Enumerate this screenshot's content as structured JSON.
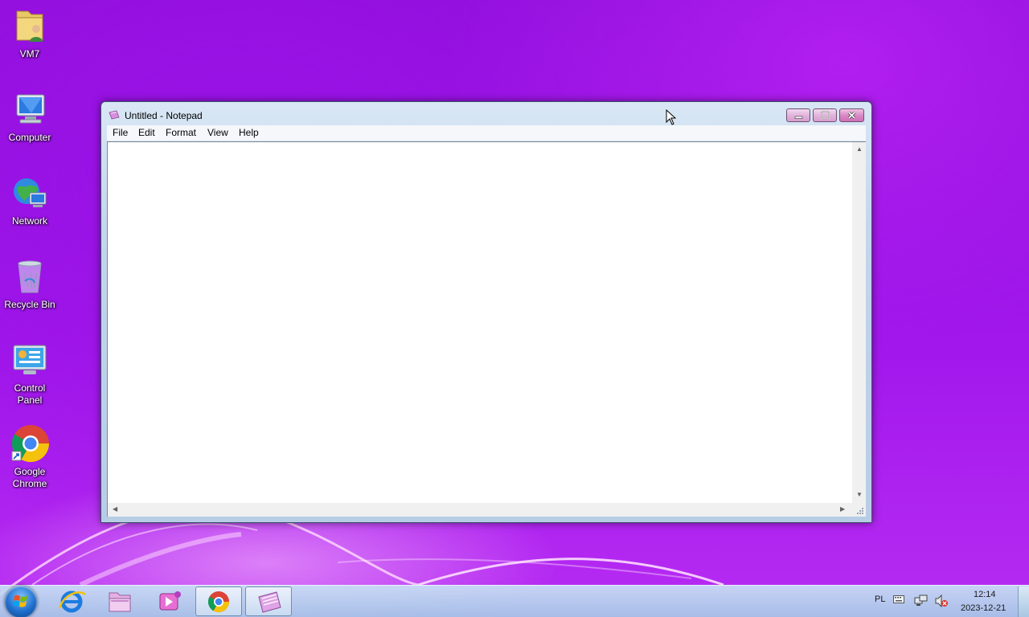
{
  "desktop": {
    "icons": [
      {
        "label": "VM7",
        "icon": "user-folder-icon"
      },
      {
        "label": "Computer",
        "icon": "computer-icon"
      },
      {
        "label": "Network",
        "icon": "network-icon"
      },
      {
        "label": "Recycle Bin",
        "icon": "recycle-bin-icon"
      },
      {
        "label_line1": "Control",
        "label_line2": "Panel",
        "icon": "control-panel-icon"
      },
      {
        "label_line1": "Google",
        "label_line2": "Chrome",
        "icon": "chrome-icon"
      }
    ]
  },
  "notepad": {
    "title": "Untitled - Notepad",
    "menu": [
      "File",
      "Edit",
      "Format",
      "View",
      "Help"
    ],
    "content": ""
  },
  "taskbar": {
    "items": [
      "internet-explorer-icon",
      "file-explorer-icon",
      "media-center-icon",
      "chrome-icon",
      "notepad-icon"
    ],
    "active_item": "notepad-icon",
    "language": "PL",
    "time": "12:14",
    "date": "2023-12-21"
  },
  "colors": {
    "wallpaper": "#9a12e6",
    "window_frame": "#c2d6ec",
    "close_button": "#d98ac6"
  }
}
